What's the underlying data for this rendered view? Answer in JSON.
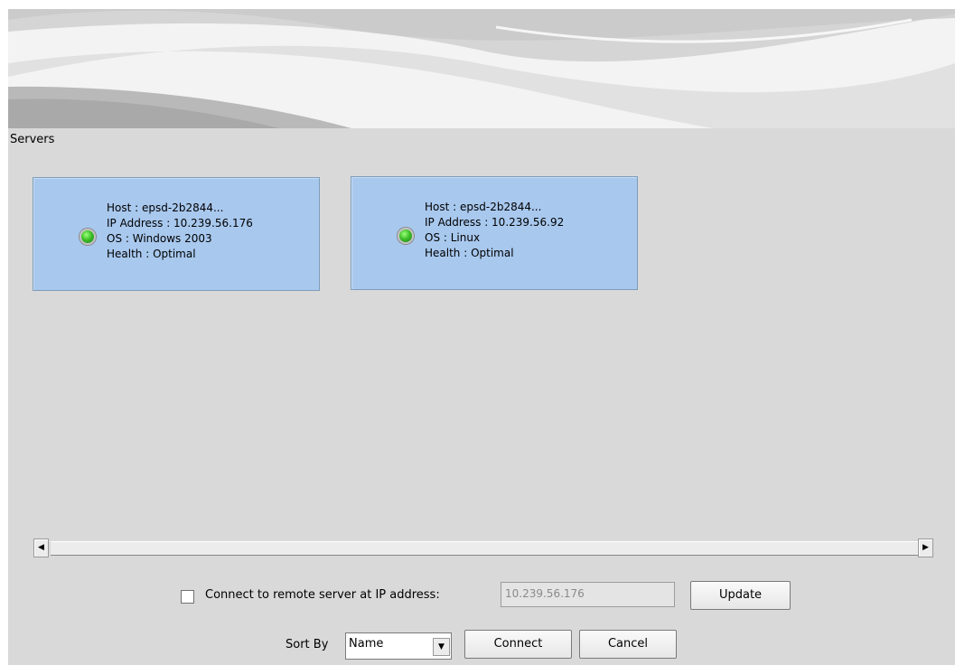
{
  "servers_panel": {
    "title": "Servers"
  },
  "servers": [
    {
      "host": "Host : epsd-2b2844...",
      "ip": "IP Address : 10.239.56.176",
      "os": "OS : Windows 2003",
      "health": "Health : Optimal",
      "status_color": "#3fc22a"
    },
    {
      "host": "Host : epsd-2b2844...",
      "ip": "IP Address : 10.239.56.92",
      "os": "OS : Linux",
      "health": "Health : Optimal",
      "status_color": "#3fc22a"
    }
  ],
  "scrollbar": {
    "left_arrow": "◀",
    "right_arrow": "▶"
  },
  "remote": {
    "checked": false,
    "label": "Connect to remote server at IP address:",
    "ip_value": "10.239.56.176",
    "update_label": "Update"
  },
  "sort": {
    "label": "Sort By",
    "selected": "Name",
    "dropdown_icon": "chevron-down-icon"
  },
  "actions": {
    "connect_label": "Connect",
    "cancel_label": "Cancel"
  }
}
